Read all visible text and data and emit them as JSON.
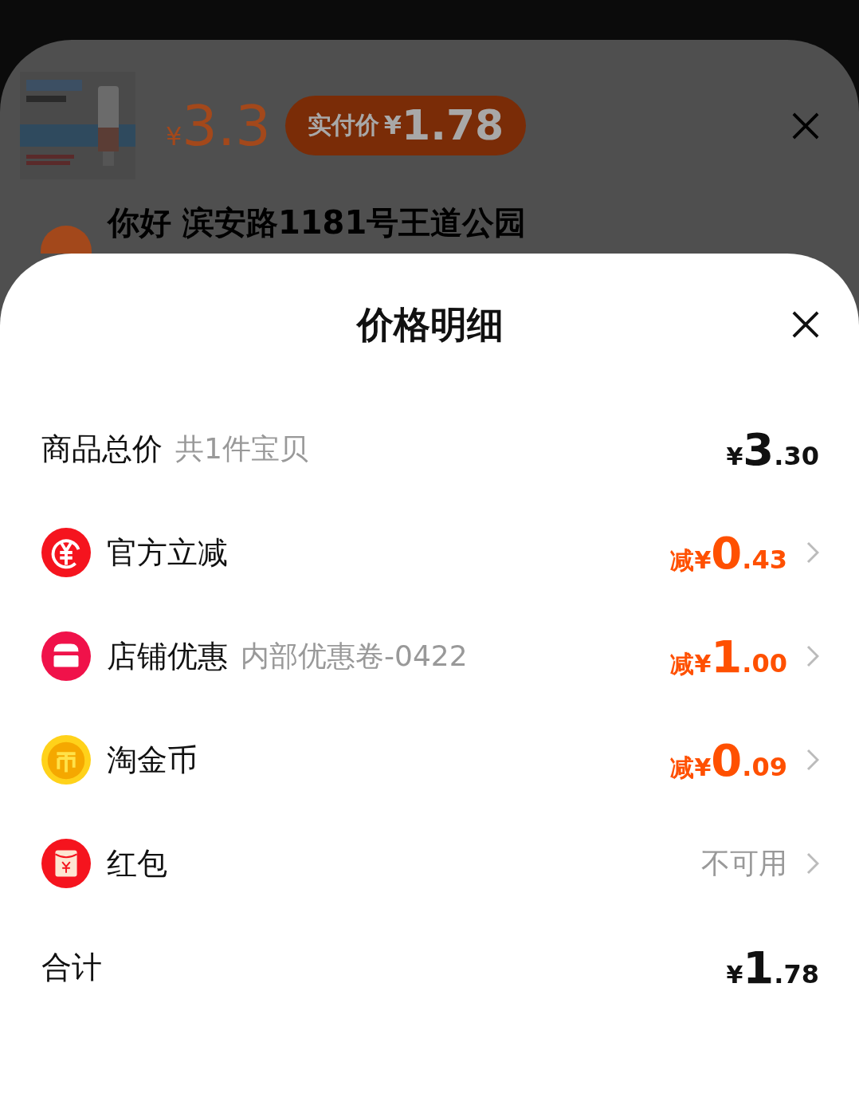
{
  "product": {
    "kind": "picture",
    "price": {
      "prefix": "¥",
      "value": "3.3"
    },
    "paid_badge": {
      "label": "实付价",
      "prefix": "¥",
      "value": "1.78"
    }
  },
  "address": {
    "text": "你好 滨安路1181号王道公园"
  },
  "sheet": {
    "title": "价格明细"
  },
  "summary": {
    "label": "商品总价",
    "note": "共1件宝贝",
    "amount": {
      "prefix": "¥",
      "int": "3",
      "dec": ".30"
    }
  },
  "items": [
    {
      "kind": "official",
      "label": "官方立减",
      "amount": {
        "prefix": "减¥",
        "int": "0",
        "dec": ".43"
      }
    },
    {
      "kind": "shop",
      "label": "店铺优惠",
      "note": "内部优惠卷-0422",
      "amount": {
        "prefix": "减¥",
        "int": "1",
        "dec": ".00"
      }
    },
    {
      "kind": "coin",
      "label": "淘金币",
      "amount": {
        "prefix": "减¥",
        "int": "0",
        "dec": ".09"
      }
    },
    {
      "kind": "redpacket",
      "label": "红包",
      "status": "不可用"
    }
  ],
  "total": {
    "label": "合计",
    "amount": {
      "prefix": "¥",
      "int": "1",
      "dec": ".78"
    }
  }
}
